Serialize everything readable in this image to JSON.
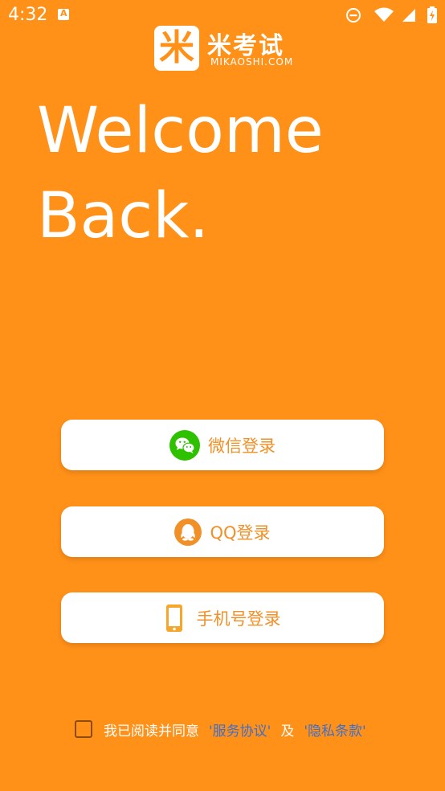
{
  "status_bar": {
    "time": "4:32",
    "app_icon": "a-notification-icon",
    "right_icons": [
      "do-not-disturb-icon",
      "wifi-icon",
      "signal-icon",
      "battery-charging-icon"
    ]
  },
  "logo": {
    "mark_char": "米",
    "name": "米考试",
    "subtitle": "MIKAOSHI.COM"
  },
  "headline": {
    "line1": "Welcome",
    "line2": "Back."
  },
  "login": {
    "wechat_label": "微信登录",
    "qq_label": "QQ登录",
    "phone_label": "手机号登录"
  },
  "agreement": {
    "text": "我已阅读并同意",
    "service_link": "'服务协议'",
    "and": "及",
    "privacy_link": "'隐私条款'",
    "checked": false
  },
  "colors": {
    "background": "#FF9018",
    "wechat_green": "#2DC100",
    "accent_text": "#F29028",
    "link_blue": "#3E6FCB"
  }
}
